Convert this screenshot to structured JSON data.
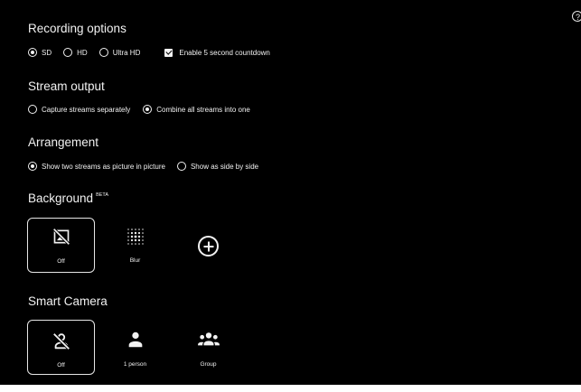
{
  "help": {
    "glyph": "?"
  },
  "recording": {
    "title": "Recording options",
    "quality": [
      {
        "label": "SD",
        "selected": true
      },
      {
        "label": "HD",
        "selected": false
      },
      {
        "label": "Ultra HD",
        "selected": false
      }
    ],
    "countdown": {
      "label": "Enable 5 second countdown",
      "checked": true
    }
  },
  "stream": {
    "title": "Stream output",
    "options": [
      {
        "label": "Capture streams separately",
        "selected": false
      },
      {
        "label": "Combine all streams into one",
        "selected": true
      }
    ]
  },
  "arrangement": {
    "title": "Arrangement",
    "options": [
      {
        "label": "Show two streams as picture in picture",
        "selected": true
      },
      {
        "label": "Show as side by side",
        "selected": false
      }
    ]
  },
  "background": {
    "title": "Background",
    "badge": "BETA",
    "tiles": [
      {
        "label": "Off",
        "icon": "no-image-icon",
        "selected": true
      },
      {
        "label": "Blur",
        "icon": "blur-icon",
        "selected": false
      }
    ],
    "add_icon": "add-circle-icon"
  },
  "smart_camera": {
    "title": "Smart Camera",
    "tiles": [
      {
        "label": "Off",
        "icon": "person-off-icon",
        "selected": true
      },
      {
        "label": "1 person",
        "icon": "person-icon",
        "selected": false
      },
      {
        "label": "Group",
        "icon": "group-icon",
        "selected": false
      }
    ]
  },
  "colors": {
    "panel_bg": "#000000",
    "text": "#f2f2f2",
    "page_bg": "#ffffff"
  }
}
